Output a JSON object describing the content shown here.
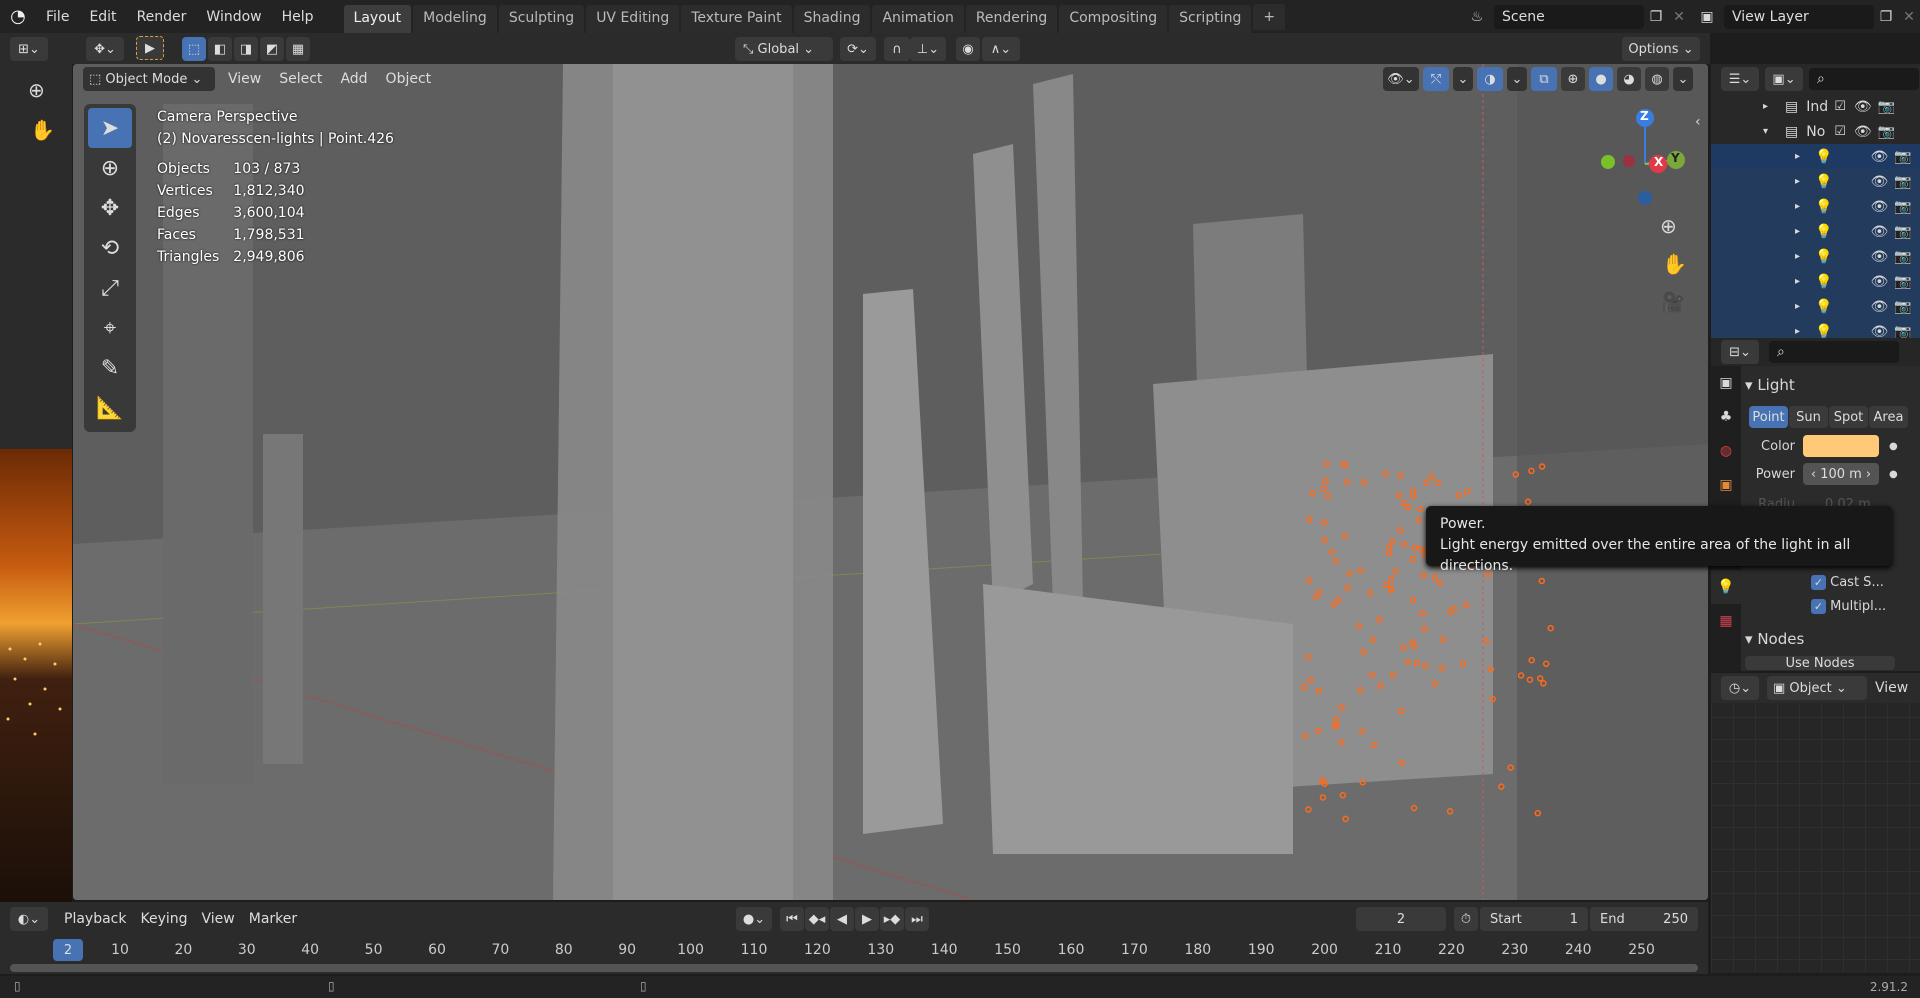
{
  "menus": [
    "File",
    "Edit",
    "Render",
    "Window",
    "Help"
  ],
  "workspaces": [
    {
      "label": "Layout",
      "active": true
    },
    {
      "label": "Modeling"
    },
    {
      "label": "Sculpting"
    },
    {
      "label": "UV Editing"
    },
    {
      "label": "Texture Paint"
    },
    {
      "label": "Shading"
    },
    {
      "label": "Animation"
    },
    {
      "label": "Rendering"
    },
    {
      "label": "Compositing"
    },
    {
      "label": "Scripting"
    }
  ],
  "add_workspace": "+",
  "scene": "Scene",
  "view_layer": "View Layer",
  "tool_header": {
    "orientation": "Global",
    "options": "Options"
  },
  "viewport": {
    "mode": "Object Mode",
    "menu": [
      "View",
      "Select",
      "Add",
      "Object"
    ],
    "camera": "Camera Perspective",
    "active": "(2) Novaresscen-lights | Point.426",
    "stats": [
      [
        "Objects",
        "103 / 873"
      ],
      [
        "Vertices",
        "1,812,340"
      ],
      [
        "Edges",
        "3,600,104"
      ],
      [
        "Faces",
        "1,798,531"
      ],
      [
        "Triangles",
        "2,949,806"
      ]
    ],
    "gizmo": {
      "z": "Z",
      "x": "X",
      "y": "Y"
    }
  },
  "tooltip": {
    "title": "Power.",
    "text": "Light energy emitted over the entire area of the light in all directions."
  },
  "outliner": {
    "rows": [
      {
        "label": "Ind",
        "type": "collection"
      },
      {
        "label": "No",
        "type": "collection"
      }
    ],
    "light_rows": 9
  },
  "properties": {
    "panel": "Light",
    "types": [
      "Point",
      "Sun",
      "Spot",
      "Area"
    ],
    "active_type": "Point",
    "color_label": "Color",
    "color": "#ffc978",
    "power_label": "Power",
    "power": "100 m",
    "radius_label": "Radiu",
    "radius": "0.02 m",
    "cast_shadow": "Cast S...",
    "multiple_importance": "Multipl...",
    "nodes_panel": "Nodes",
    "use_nodes": "Use Nodes"
  },
  "bottom_editor": {
    "mode": "Object",
    "view": "View"
  },
  "timeline": {
    "menus": [
      "Playback",
      "Keying",
      "View",
      "Marker"
    ],
    "current_frame": "2",
    "start_label": "Start",
    "start": "1",
    "end_label": "End",
    "end": "250",
    "ticks": [
      "10",
      "20",
      "30",
      "40",
      "50",
      "60",
      "70",
      "80",
      "90",
      "100",
      "110",
      "120",
      "130",
      "140",
      "150",
      "160",
      "170",
      "180",
      "190",
      "200",
      "210",
      "220",
      "230",
      "240",
      "250"
    ]
  },
  "version": "2.91.2",
  "colors": {
    "accent": "#4772b3",
    "selection": "#1e3a63",
    "light_icon": "#e08a3c"
  }
}
